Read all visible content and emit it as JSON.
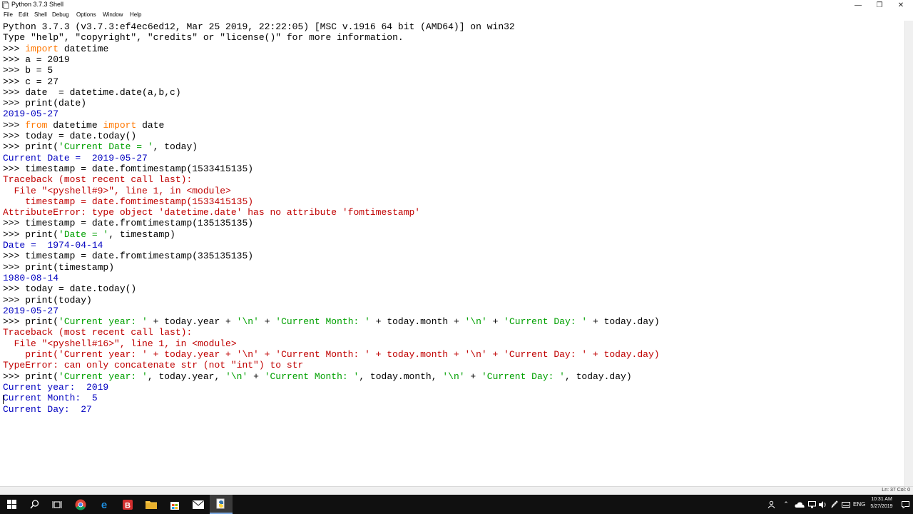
{
  "window": {
    "title": "Python 3.7.3 Shell"
  },
  "menu": [
    "File",
    "Edit",
    "Shell",
    "Debug",
    "Options",
    "Window",
    "Help"
  ],
  "shell_lines": [
    [
      {
        "t": "Python 3.7.3 (v3.7.3:ef4ec6ed12, Mar 25 2019, 22:22:05) [MSC v.1916 64 bit (AMD64)] on win32",
        "c": "black"
      }
    ],
    [
      {
        "t": "Type \"help\", \"copyright\", \"credits\" or \"license()\" for more information.",
        "c": "black"
      }
    ],
    [
      {
        "t": ">>> ",
        "c": "black"
      },
      {
        "t": "import",
        "c": "kw"
      },
      {
        "t": " datetime",
        "c": "black"
      }
    ],
    [
      {
        "t": ">>> a = 2019",
        "c": "black"
      }
    ],
    [
      {
        "t": ">>> b = 5",
        "c": "black"
      }
    ],
    [
      {
        "t": ">>> c = 27",
        "c": "black"
      }
    ],
    [
      {
        "t": ">>> date  = datetime.date(a,b,c)",
        "c": "black"
      }
    ],
    [
      {
        "t": ">>> print(date)",
        "c": "black"
      }
    ],
    [
      {
        "t": "2019-05-27",
        "c": "out"
      }
    ],
    [
      {
        "t": ">>> ",
        "c": "black"
      },
      {
        "t": "from",
        "c": "kw"
      },
      {
        "t": " datetime ",
        "c": "black"
      },
      {
        "t": "import",
        "c": "kw"
      },
      {
        "t": " date",
        "c": "black"
      }
    ],
    [
      {
        "t": ">>> today = date.today()",
        "c": "black"
      }
    ],
    [
      {
        "t": ">>> print(",
        "c": "black"
      },
      {
        "t": "'Current Date = '",
        "c": "str"
      },
      {
        "t": ", today)",
        "c": "black"
      }
    ],
    [
      {
        "t": "Current Date =  2019-05-27",
        "c": "out"
      }
    ],
    [
      {
        "t": ">>> timestamp = date.fomtimestamp(1533415135)",
        "c": "black"
      }
    ],
    [
      {
        "t": "Traceback (most recent call last):",
        "c": "err"
      }
    ],
    [
      {
        "t": "  File \"<pyshell#9>\", line 1, in <module>",
        "c": "err"
      }
    ],
    [
      {
        "t": "    timestamp = date.fomtimestamp(1533415135)",
        "c": "err"
      }
    ],
    [
      {
        "t": "AttributeError: type object 'datetime.date' has no attribute 'fomtimestamp'",
        "c": "err"
      }
    ],
    [
      {
        "t": ">>> timestamp = date.fromtimestamp(135135135)",
        "c": "black"
      }
    ],
    [
      {
        "t": ">>> print(",
        "c": "black"
      },
      {
        "t": "'Date = '",
        "c": "str"
      },
      {
        "t": ", timestamp)",
        "c": "black"
      }
    ],
    [
      {
        "t": "Date =  1974-04-14",
        "c": "out"
      }
    ],
    [
      {
        "t": ">>> timestamp = date.fromtimestamp(335135135)",
        "c": "black"
      }
    ],
    [
      {
        "t": ">>> print(timestamp)",
        "c": "black"
      }
    ],
    [
      {
        "t": "1980-08-14",
        "c": "out"
      }
    ],
    [
      {
        "t": ">>> today = date.today()",
        "c": "black"
      }
    ],
    [
      {
        "t": ">>> print(today)",
        "c": "black"
      }
    ],
    [
      {
        "t": "2019-05-27",
        "c": "out"
      }
    ],
    [
      {
        "t": ">>> print(",
        "c": "black"
      },
      {
        "t": "'Current year: '",
        "c": "str"
      },
      {
        "t": " + today.year + ",
        "c": "black"
      },
      {
        "t": "'\\n'",
        "c": "str"
      },
      {
        "t": " + ",
        "c": "black"
      },
      {
        "t": "'Current Month: '",
        "c": "str"
      },
      {
        "t": " + today.month + ",
        "c": "black"
      },
      {
        "t": "'\\n'",
        "c": "str"
      },
      {
        "t": " + ",
        "c": "black"
      },
      {
        "t": "'Current Day: '",
        "c": "str"
      },
      {
        "t": " + today.day)",
        "c": "black"
      }
    ],
    [
      {
        "t": "Traceback (most recent call last):",
        "c": "err"
      }
    ],
    [
      {
        "t": "  File \"<pyshell#16>\", line 1, in <module>",
        "c": "err"
      }
    ],
    [
      {
        "t": "    print('Current year: ' + today.year + '\\n' + 'Current Month: ' + today.month + '\\n' + 'Current Day: ' + today.day)",
        "c": "err"
      }
    ],
    [
      {
        "t": "TypeError: can only concatenate str (not \"int\") to str",
        "c": "err"
      }
    ],
    [
      {
        "t": ">>> print(",
        "c": "black"
      },
      {
        "t": "'Current year: '",
        "c": "str"
      },
      {
        "t": ", today.year, ",
        "c": "black"
      },
      {
        "t": "'\\n'",
        "c": "str"
      },
      {
        "t": " + ",
        "c": "black"
      },
      {
        "t": "'Current Month: '",
        "c": "str"
      },
      {
        "t": ", today.month, ",
        "c": "black"
      },
      {
        "t": "'\\n'",
        "c": "str"
      },
      {
        "t": " + ",
        "c": "black"
      },
      {
        "t": "'Current Day: '",
        "c": "str"
      },
      {
        "t": ", today.day)",
        "c": "black"
      }
    ],
    [
      {
        "t": "Current year:  2019",
        "c": "out"
      }
    ],
    [
      {
        "t": "Current Month:  5",
        "c": "out"
      }
    ],
    [
      {
        "t": "Current Day:  27",
        "c": "out"
      }
    ]
  ],
  "status": {
    "position": "Ln: 37  Col: 0"
  },
  "tray": {
    "language": "ENG",
    "time": "10:31 AM",
    "date": "5/27/2019"
  },
  "colors": {
    "prompt": "#000000",
    "output": "#0000c0",
    "error": "#c00000",
    "string": "#00a000",
    "keyword": "#ff7700"
  }
}
